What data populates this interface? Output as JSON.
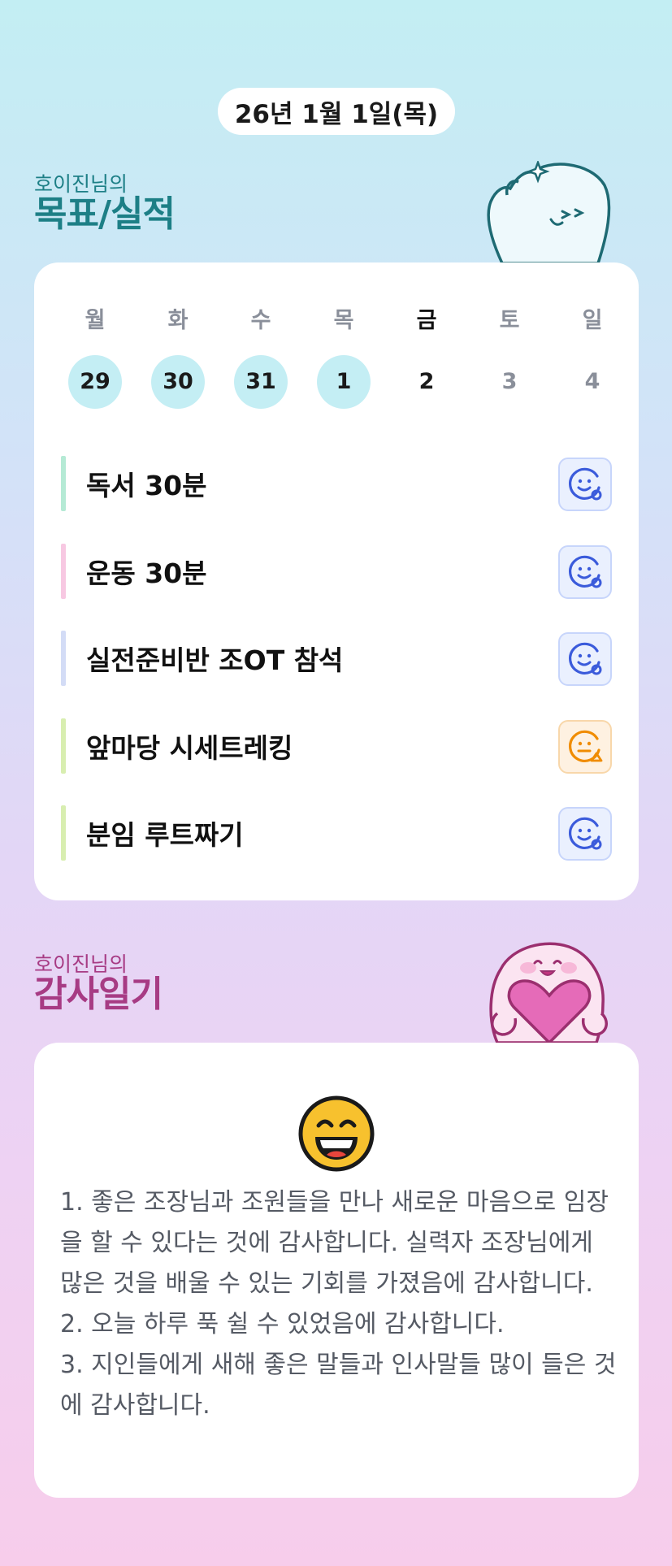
{
  "date": "26년 1월 1일(목)",
  "goal_section": {
    "subtitle": "호이진님의",
    "title": "목표/실적"
  },
  "week": {
    "days": [
      {
        "name": "월",
        "num": "29",
        "state": "done"
      },
      {
        "name": "화",
        "num": "30",
        "state": "done"
      },
      {
        "name": "수",
        "num": "31",
        "state": "done"
      },
      {
        "name": "목",
        "num": "1",
        "state": "done"
      },
      {
        "name": "금",
        "num": "2",
        "state": "today"
      },
      {
        "name": "토",
        "num": "3",
        "state": "future"
      },
      {
        "name": "일",
        "num": "4",
        "state": "future"
      }
    ]
  },
  "goals": [
    {
      "label": "독서 30분",
      "bar_color": "#b5ead5",
      "status": "smile-icon",
      "status_color": "#3b5bdb"
    },
    {
      "label": "운동 30분",
      "bar_color": "#f7c8e2",
      "status": "smile-icon",
      "status_color": "#3b5bdb"
    },
    {
      "label": "실전준비반 조OT 참석",
      "bar_color": "#d3dcf6",
      "status": "smile-icon",
      "status_color": "#3b5bdb"
    },
    {
      "label": "앞마당 시세트레킹",
      "bar_color": "#d8eeb0",
      "status": "neutral-warning-icon",
      "status_color": "#f08c00"
    },
    {
      "label": "분임 루트짜기",
      "bar_color": "#d8eeb0",
      "status": "smile-icon",
      "status_color": "#3b5bdb"
    }
  ],
  "thanks_section": {
    "subtitle": "호이진님의",
    "title": "감사일기",
    "emoji": "grinning-face-icon",
    "text": "1. 좋은 조장님과 조원들을 만나 새로운 마음으로 임장을 할 수 있다는 것에 감사합니다. 실력자 조장님에게 많은 것을 배울 수 있는 기회를 가졌음에 감사합니다.\n2. 오늘 하루 푹 쉴 수 있었음에 감사합니다.\n3. 지인들에게 새해 좋은 말들과 인사말들 많이 들은 것에 감사합니다."
  }
}
